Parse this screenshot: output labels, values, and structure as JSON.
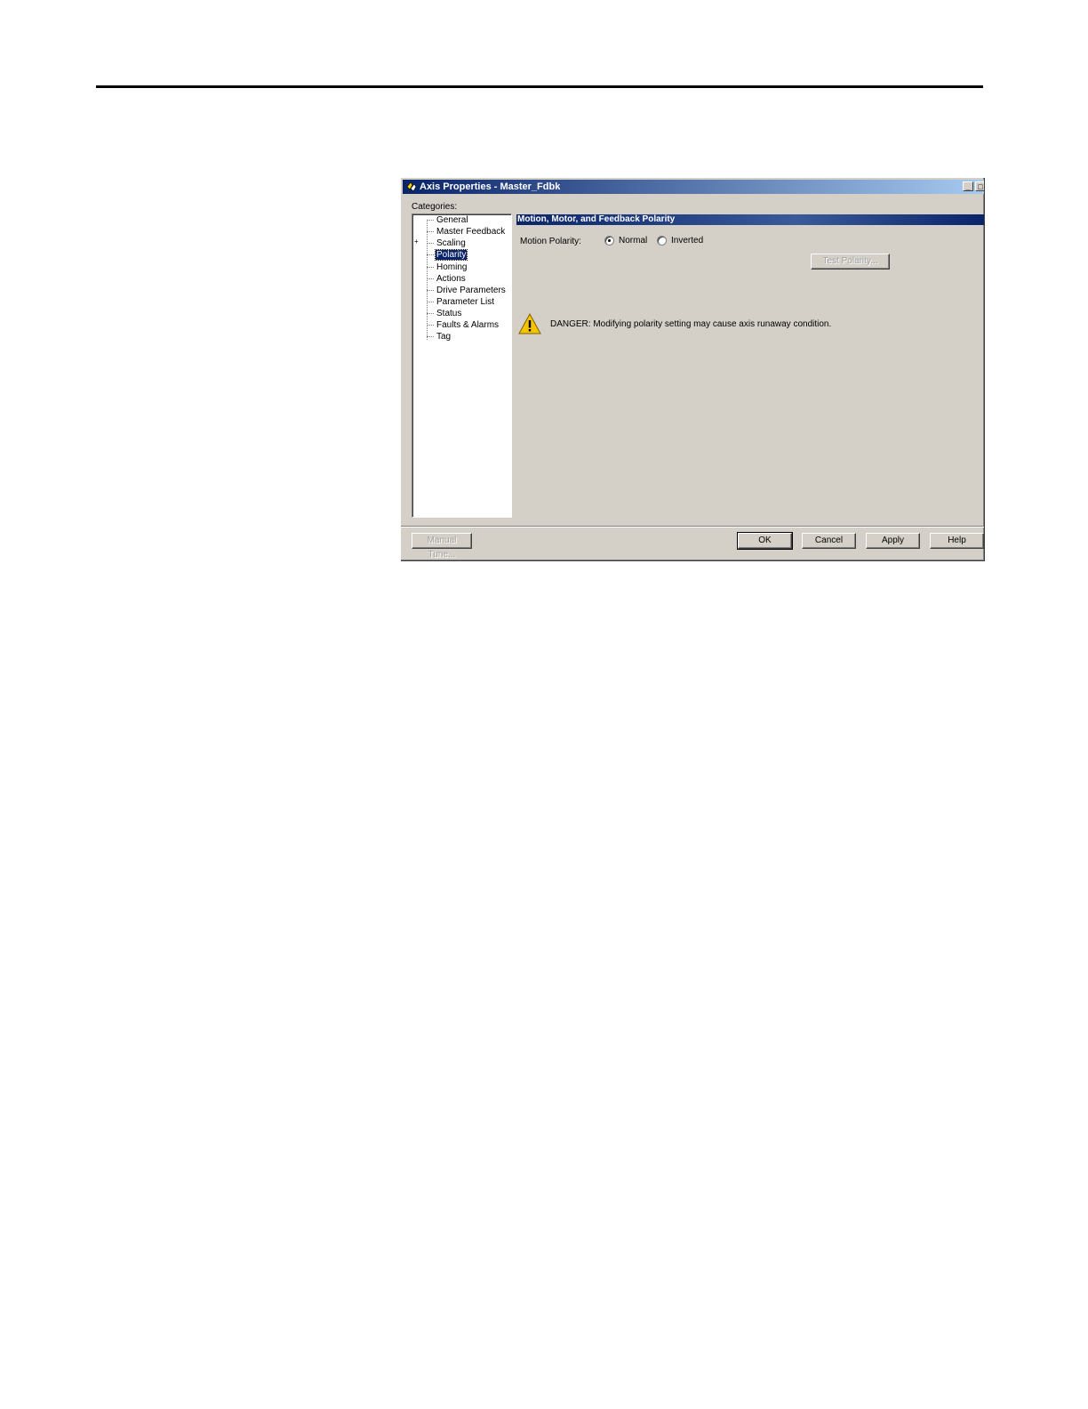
{
  "window": {
    "title": "Axis Properties - Master_Fdbk",
    "minimize_glyph": "_",
    "maximize_glyph": "□"
  },
  "categories": {
    "label": "Categories:",
    "items": [
      {
        "label": "General"
      },
      {
        "label": "Master Feedback"
      },
      {
        "label": "Scaling"
      },
      {
        "label": "Polarity"
      },
      {
        "label": "Homing"
      },
      {
        "label": "Actions"
      },
      {
        "label": "Drive Parameters"
      },
      {
        "label": "Parameter List"
      },
      {
        "label": "Status"
      },
      {
        "label": "Faults & Alarms"
      },
      {
        "label": "Tag"
      }
    ],
    "selected": "Polarity",
    "expander_glyph": "+"
  },
  "section": {
    "title": "Motion, Motor, and Feedback Polarity"
  },
  "polarity": {
    "label": "Motion Polarity:",
    "options": [
      "Normal",
      "Inverted"
    ],
    "selected": "Normal"
  },
  "buttons": {
    "test_polarity": "Test Polarity...",
    "manual_tune": "Manual Tune...",
    "ok": "OK",
    "cancel": "Cancel",
    "apply": "Apply",
    "help": "Help"
  },
  "warning": {
    "icon": "warning-triangle-icon",
    "text": "DANGER: Modifying polarity setting may cause axis runaway condition."
  },
  "colors": {
    "title_bar": "#0a246a",
    "dialog_bg": "#d4d0c8",
    "selection": "#0a246a",
    "warning_fill": "#f5c400"
  }
}
